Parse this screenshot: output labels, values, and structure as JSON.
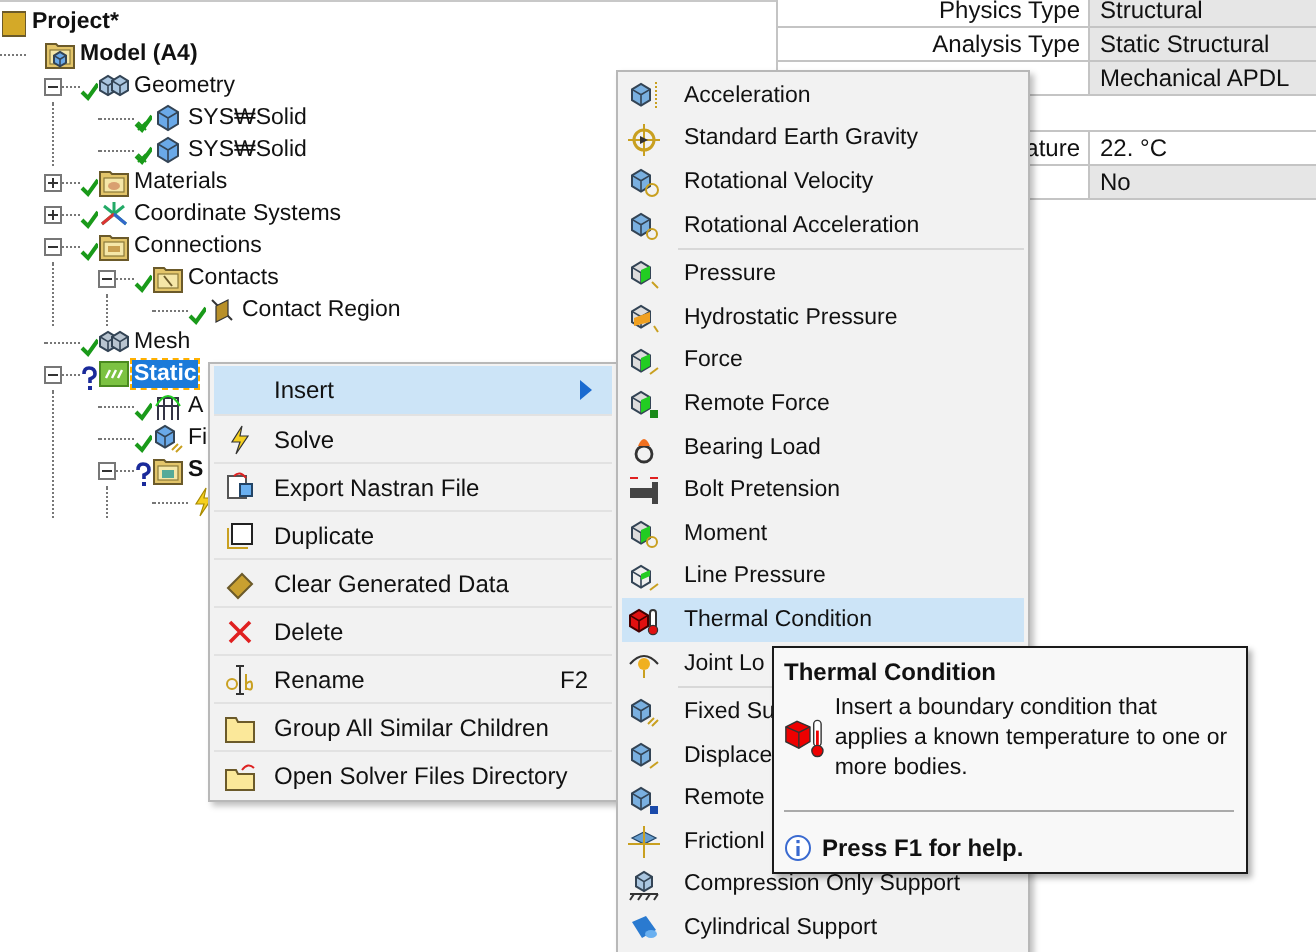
{
  "tree": {
    "label": "Project*",
    "kind": "project",
    "selected": false,
    "children": [
      {
        "label": "Model (A4)",
        "kind": "model",
        "selected": false,
        "children": [
          {
            "label": "Geometry",
            "kind": "geometry",
            "complete": true,
            "expanded": true,
            "selected": false,
            "children": [
              {
                "label": "SYS₩Solid",
                "kind": "body",
                "complete": true,
                "flagged": true,
                "selected": false
              },
              {
                "label": "SYS₩Solid",
                "kind": "body",
                "complete": true,
                "flagged": true,
                "selected": false
              }
            ]
          },
          {
            "label": "Materials",
            "kind": "materials",
            "complete": true,
            "expanded": false,
            "selected": false
          },
          {
            "label": "Coordinate Systems",
            "kind": "coordinates",
            "complete": true,
            "expanded": false,
            "selected": false
          },
          {
            "label": "Connections",
            "kind": "connections",
            "complete": true,
            "expanded": true,
            "selected": false,
            "children": [
              {
                "label": "Contacts",
                "kind": "contacts",
                "complete": true,
                "expanded": true,
                "selected": false,
                "children": [
                  {
                    "label": "Contact Region",
                    "kind": "contact",
                    "complete": true,
                    "selected": false
                  }
                ]
              }
            ]
          },
          {
            "label": "Mesh",
            "kind": "mesh",
            "complete": true,
            "selected": false
          },
          {
            "label": "Static",
            "kind": "analysis",
            "complete": false,
            "expanded": true,
            "selected": true,
            "children": [
              {
                "label": "A",
                "kind": "settings",
                "complete": true,
                "selected": false
              },
              {
                "label": "Fi",
                "kind": "support",
                "complete": true,
                "selected": false
              },
              {
                "label": "S",
                "kind": "solution",
                "complete": false,
                "expanded": true,
                "selected": false,
                "children": [
                  {
                    "kind": "solution-info"
                  }
                ]
              }
            ]
          }
        ]
      }
    ]
  },
  "details": {
    "rows": [
      {
        "kind": "property",
        "label": "Physics Type",
        "value": "Structural",
        "readonly": true
      },
      {
        "kind": "property",
        "label": "Analysis Type",
        "value": "Static Structural",
        "readonly": true
      },
      {
        "kind": "property",
        "value": "Mechanical APDL",
        "readonly": true
      },
      {
        "kind": "header"
      },
      {
        "kind": "property",
        "label": "ature",
        "value": "22. °C",
        "readonly": false
      },
      {
        "kind": "property",
        "value": "No",
        "readonly": true
      }
    ]
  },
  "context_menu": {
    "items": [
      {
        "label": "Insert",
        "selected": true,
        "submenu": true
      },
      {
        "label": "Solve",
        "selected": false
      },
      {
        "label": "Export Nastran File",
        "selected": false
      },
      {
        "label": "Duplicate",
        "selected": false
      },
      {
        "label": "Clear Generated Data",
        "selected": false
      },
      {
        "label": "Delete",
        "selected": false
      },
      {
        "label": "Rename",
        "shortcut": "F2",
        "selected": false
      },
      {
        "label": "Group All Similar Children",
        "selected": false
      },
      {
        "label": "Open Solver Files Directory",
        "selected": false
      }
    ]
  },
  "submenu": {
    "groups": [
      [
        {
          "label": "Acceleration",
          "selected": false
        },
        {
          "label": "Standard Earth Gravity",
          "selected": false
        },
        {
          "label": "Rotational Velocity",
          "selected": false
        },
        {
          "label": "Rotational Acceleration",
          "selected": false
        }
      ],
      [
        {
          "label": "Pressure",
          "selected": false
        },
        {
          "label": "Hydrostatic Pressure",
          "selected": false
        },
        {
          "label": "Force",
          "selected": false
        },
        {
          "label": "Remote Force",
          "selected": false
        },
        {
          "label": "Bearing Load",
          "selected": false
        },
        {
          "label": "Bolt Pretension",
          "selected": false
        },
        {
          "label": "Moment",
          "selected": false
        },
        {
          "label": "Line Pressure",
          "selected": false
        },
        {
          "label": "Thermal Condition",
          "selected": true
        },
        {
          "label": "Joint Lo",
          "selected": false
        }
      ],
      [
        {
          "label": "Fixed Su",
          "selected": false
        },
        {
          "label": "Displace",
          "selected": false
        },
        {
          "label": "Remote",
          "selected": false
        },
        {
          "label": "Frictionl",
          "selected": false
        },
        {
          "label": "Compression Only Support",
          "selected": false
        },
        {
          "label": "Cylindrical Support",
          "selected": false
        }
      ]
    ]
  },
  "tooltip": {
    "title": "Thermal Condition",
    "description": "Insert a boundary condition that applies a known temperature to one or more bodies.",
    "help": "Press F1 for help."
  }
}
